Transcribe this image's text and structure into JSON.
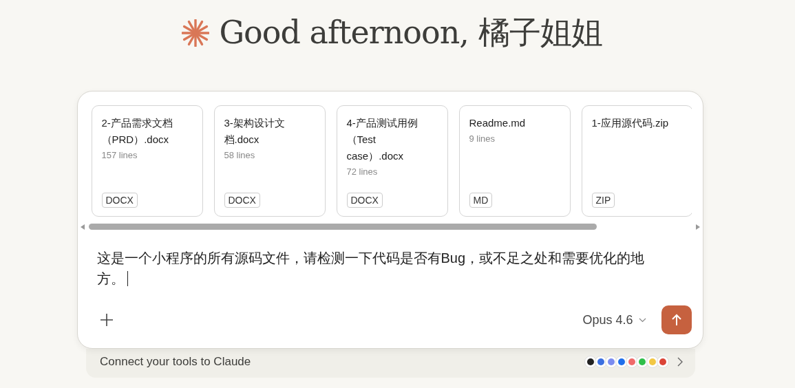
{
  "greeting": "Good afternoon, 橘子姐姐",
  "attachments": [
    {
      "name": "2-产品需求文档（PRD）.docx",
      "lines": "157 lines",
      "type": "DOCX"
    },
    {
      "name": "3-架构设计文档.docx",
      "lines": "58 lines",
      "type": "DOCX"
    },
    {
      "name": "4-产品测试用例（Test case）.docx",
      "lines": "72 lines",
      "type": "DOCX"
    },
    {
      "name": "Readme.md",
      "lines": "9 lines",
      "type": "MD"
    },
    {
      "name": "1-应用源代码.zip",
      "type": "ZIP"
    }
  ],
  "prompt": "这是一个小程序的所有源码文件，请检测一下代码是否有Bug，或不足之处和需要优化的地方。",
  "model": "Opus 4.6",
  "connect": "Connect your tools to Claude",
  "tool_icons": [
    {
      "color": "#222222"
    },
    {
      "color": "#3b6fe0"
    },
    {
      "color": "#7b8cf0"
    },
    {
      "color": "#1f6feb"
    },
    {
      "color": "#f06a6a"
    },
    {
      "color": "#2fbf4a"
    },
    {
      "color": "#f2c744"
    },
    {
      "color": "#db4437"
    }
  ]
}
